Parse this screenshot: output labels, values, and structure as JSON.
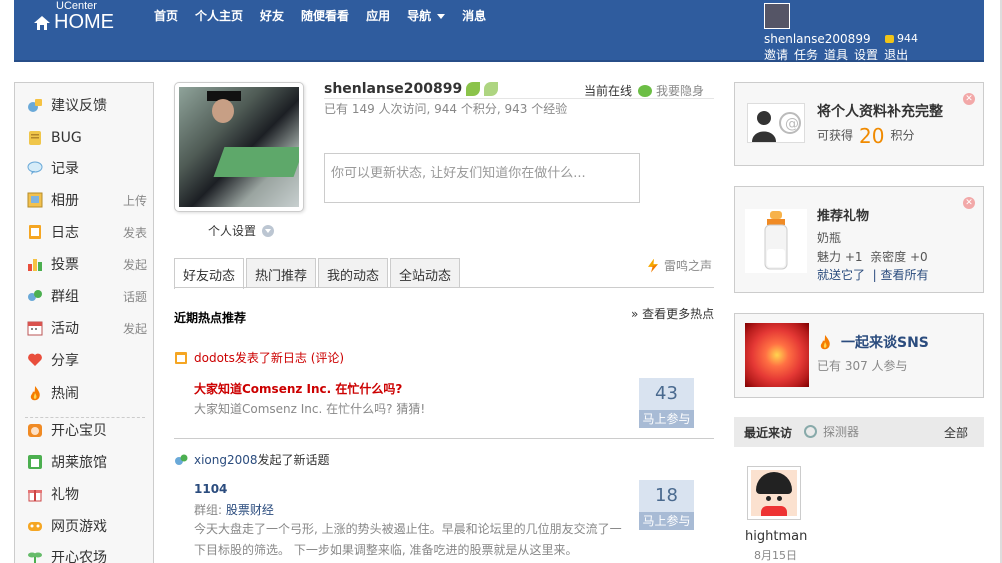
{
  "header": {
    "logo_small": "UCenter",
    "logo_big": "HOME",
    "nav": [
      "首页",
      "个人主页",
      "好友",
      "随便看看",
      "应用",
      "导航",
      "消息"
    ],
    "username": "shenlanse200899",
    "coins": "944",
    "user_links": [
      "邀请",
      "任务",
      "道具",
      "设置",
      "退出"
    ]
  },
  "sidebar": {
    "items": [
      {
        "label": "建议反馈",
        "sub": "",
        "icon": "feedback-icon"
      },
      {
        "label": "BUG",
        "sub": "",
        "icon": "bug-icon"
      },
      {
        "label": "记录",
        "sub": "",
        "icon": "bubble-icon"
      },
      {
        "label": "相册",
        "sub": "上传",
        "icon": "album-icon"
      },
      {
        "label": "日志",
        "sub": "发表",
        "icon": "blog-icon"
      },
      {
        "label": "投票",
        "sub": "发起",
        "icon": "poll-icon"
      },
      {
        "label": "群组",
        "sub": "话题",
        "icon": "group-icon"
      },
      {
        "label": "活动",
        "sub": "发起",
        "icon": "calendar-icon"
      },
      {
        "label": "分享",
        "sub": "",
        "icon": "share-icon"
      },
      {
        "label": "热闹",
        "sub": "",
        "icon": "fire-icon"
      },
      {
        "label": "开心宝贝",
        "sub": "",
        "icon": "baby-icon"
      },
      {
        "label": "胡莱旅馆",
        "sub": "",
        "icon": "hotel-icon"
      },
      {
        "label": "礼物",
        "sub": "",
        "icon": "gift-icon"
      },
      {
        "label": "网页游戏",
        "sub": "",
        "icon": "game-icon"
      },
      {
        "label": "开心农场",
        "sub": "",
        "icon": "farm-icon"
      }
    ]
  },
  "profile": {
    "settings_label": "个人设置",
    "name": "shenlanse200899",
    "online": "当前在线",
    "hide": "我要隐身",
    "stats": "已有  149 人次访问, 944 个积分, 943 个经验",
    "status_placeholder": "你可以更新状态, 让好友们知道你在做什么..."
  },
  "tabs": [
    "好友动态",
    "热门推荐",
    "我的动态",
    "全站动态"
  ],
  "thunder": "雷鸣之声",
  "hot": {
    "title": "近期热点推荐",
    "more": "» 查看更多热点"
  },
  "feeds": [
    {
      "head_user": "dodots",
      "head_action": " 发表了新日志 (评论)",
      "title": "大家知道Comsenz Inc. 在忙什么吗?",
      "desc": "大家知道Comsenz Inc. 在忙什么吗?  猜猜!",
      "count": "43",
      "join": "马上参与"
    },
    {
      "head_user": "xiong2008",
      "head_action": " 发起了新话题",
      "title": "1104",
      "group_label": "群组: ",
      "group_name": "股票财经",
      "desc1": "今天大盘走了一个弓形, 上涨的势头被遏止住。早晨和论坛里的几位朋友交流了一",
      "desc2": "下目标股的筛选。 下一步如果调整来临, 准备吃进的股票就是从这里来。",
      "count": "18",
      "join": "马上参与"
    }
  ],
  "right": {
    "complete": {
      "title": "将个人资料补充完整",
      "gain": "可获得",
      "score": "20",
      "unit": "积分"
    },
    "gift": {
      "title": "推荐礼物",
      "name": "奶瓶",
      "charm": "魅力 +1",
      "intimacy": "亲密度 +0",
      "send": "就送它了",
      "view_all": "| 查看所有"
    },
    "sns": {
      "title": "一起来谈SNS",
      "joined": "已有  307  人参与"
    },
    "visitors": {
      "title": "最近来访",
      "radar": "探测器",
      "all": "全部",
      "name": "hightman",
      "date": "8月15日"
    }
  },
  "colors": {
    "header_bg": "#2f5c9e",
    "link_red": "#cc0000",
    "link_blue": "#2b4c7e",
    "score_orange": "#f08a00"
  }
}
